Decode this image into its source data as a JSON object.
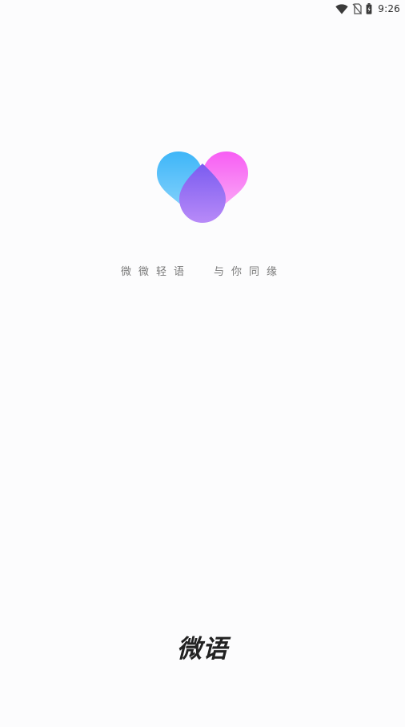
{
  "status_bar": {
    "time": "9:26",
    "icons": [
      "wifi-icon",
      "no-sim-icon",
      "battery-icon"
    ]
  },
  "splash": {
    "logo": "heart-drops-logo",
    "slogan_part1": "微微轻语",
    "slogan_part2": "与你同缘",
    "app_name": "微语"
  },
  "colors": {
    "background": "#fcfcfd",
    "logo_blue": "#3db5f7",
    "logo_pink": "#f55ff5",
    "logo_purple": "#9a6cf5",
    "text_gray": "#7a7a7a",
    "brand_text": "#222222"
  }
}
